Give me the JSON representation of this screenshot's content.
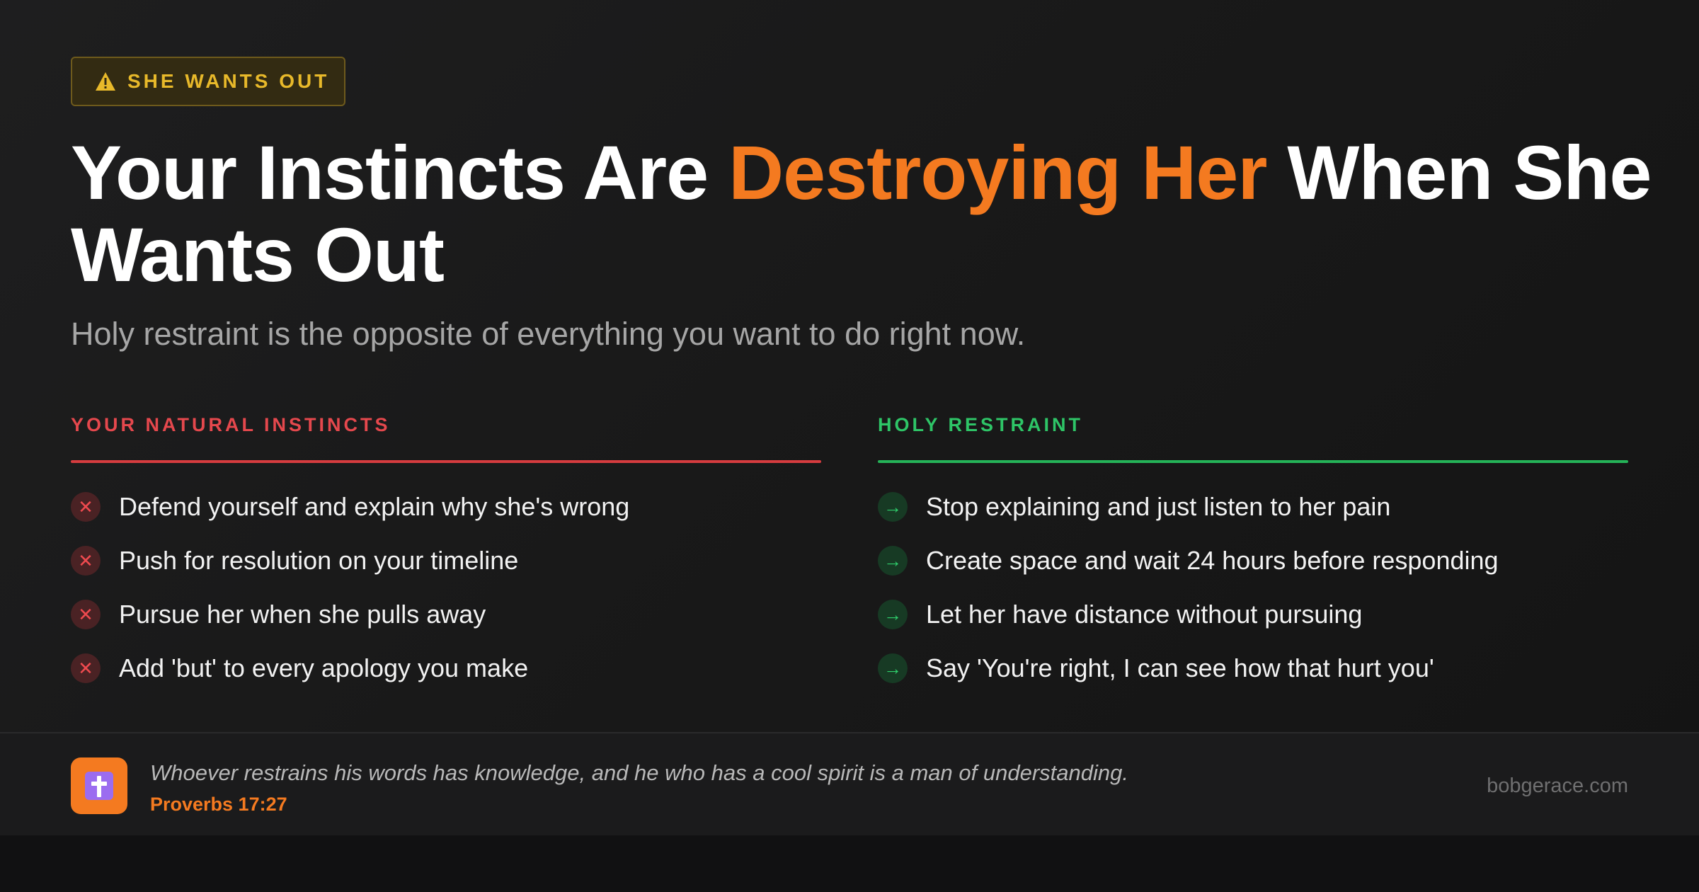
{
  "badge": {
    "icon": "warning-triangle-icon",
    "label": "SHE WANTS OUT",
    "color": "#e8b92a"
  },
  "headline": {
    "part1": "Your Instincts Are ",
    "accent": "Destroying Her",
    "part2": " When She Wants Out",
    "accent_color": "#f47a20"
  },
  "subhead": "Holy restraint is the opposite of everything you want to do right now.",
  "instincts": {
    "title": "YOUR NATURAL INSTINCTS",
    "color": "#e5484d",
    "icon": "x-icon",
    "mark": "✕",
    "items": [
      "Defend yourself and explain why she's wrong",
      "Push for resolution on your timeline",
      "Pursue her when she pulls away",
      "Add 'but' to every apology you make"
    ]
  },
  "restraint": {
    "title": "HOLY RESTRAINT",
    "color": "#2ec567",
    "icon": "arrow-right-icon",
    "mark": "→",
    "items": [
      "Stop explaining and just listen to her pain",
      "Create space and wait 24 hours before responding",
      "Let her have distance without pursuing",
      "Say 'You're right, I can see how that hurt you'"
    ]
  },
  "footer": {
    "icon": "cross-icon",
    "quote": "Whoever restrains his words has knowledge, and he who has a cool spirit is a man of understanding.",
    "reference": "Proverbs 17:27",
    "site": "bobgerace.com"
  }
}
